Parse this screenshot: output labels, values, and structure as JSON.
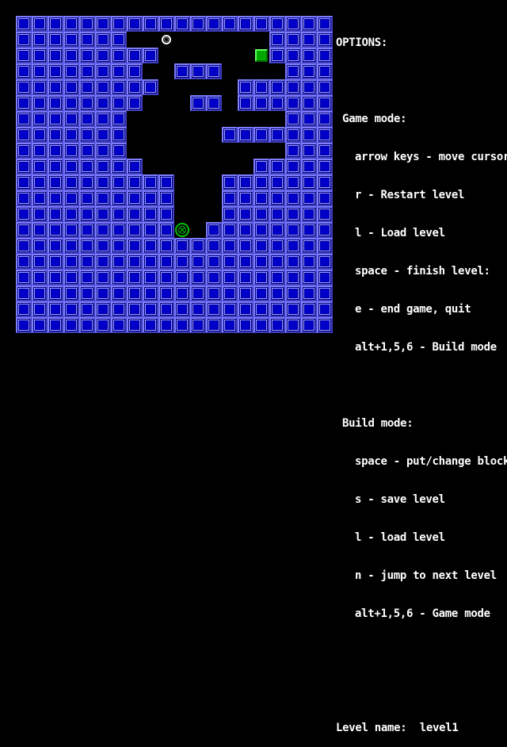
{
  "options": {
    "title": "OPTIONS:",
    "game_mode": {
      "heading": "Game mode:",
      "items": [
        "arrow keys - move cursor",
        "r - Restart level",
        "l - Load level",
        "space - finish level:",
        "e - end game, quit",
        "alt+1,5,6 - Build mode"
      ]
    },
    "build_mode": {
      "heading": "Build mode:",
      "items": [
        "space - put/change block",
        "s - save level",
        "l - load level",
        "n - jump to next level",
        "alt+1,5,6 - Game mode"
      ]
    },
    "level_label": "Level name:",
    "level_name": "level1"
  },
  "board": {
    "columns": 20,
    "rows": 20,
    "legend": {
      "#": "wall",
      ".": "empty",
      "G": "goal",
      "C": "cursor",
      "B": "ball"
    },
    "grid": [
      "####################",
      "#######..C......####",
      "#########......G####",
      "########..###....###",
      "#########.....######",
      "########...##.######",
      "#######..........#####",
      "#######......#######",
      "#######..........#####",
      "########.......#####",
      "##########...#######",
      "##########...#######",
      "##########...#######",
      "##########B.########",
      "####################",
      "####################",
      "####################",
      "####################",
      "####################",
      "####################"
    ]
  }
}
